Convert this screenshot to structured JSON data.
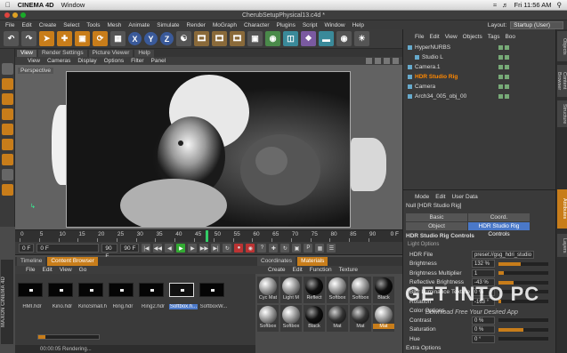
{
  "mac_menubar": {
    "app": "CINEMA 4D",
    "window_menu": "Window",
    "clock": "Fri 11:56 AM"
  },
  "window_title": "CherubSetupPhysical13.c4d *",
  "menu": [
    "File",
    "Edit",
    "Create",
    "Select",
    "Tools",
    "Mesh",
    "Animate",
    "Simulate",
    "Render",
    "MoGraph",
    "Character",
    "Plugins",
    "Script",
    "Window",
    "Help"
  ],
  "layout_label": "Layout:",
  "layout_value": "Startup (User)",
  "toolbar_axes": [
    "X",
    "Y",
    "Z"
  ],
  "viewport": {
    "tabs": [
      "View",
      "Render Settings",
      "Picture Viewer",
      "Help"
    ],
    "menu": [
      "View",
      "Cameras",
      "Display",
      "Options",
      "Filter",
      "Panel"
    ],
    "label": "Perspective"
  },
  "timeline": {
    "ticks": [
      "0",
      "5",
      "10",
      "15",
      "20",
      "25",
      "30",
      "35",
      "40",
      "45",
      "50",
      "55",
      "60",
      "65",
      "70",
      "75",
      "80",
      "85",
      "90"
    ],
    "end_label": "0 F",
    "playhead_frame": 48
  },
  "transport": {
    "start": "0 F",
    "preview_start": "0 F",
    "preview_end": "90 F",
    "end": "90 F"
  },
  "content_browser": {
    "tabs": [
      "Timeline",
      "Content Browser"
    ],
    "menu": [
      "File",
      "Edit",
      "View",
      "Go"
    ],
    "items": [
      "HMI.hdr",
      "Kino.hdr",
      "KinoSmall.hdr",
      "Ring.hdr",
      "Ring2.hdr",
      "Softbox.h...",
      "SoftboxW..."
    ],
    "selected_index": 5,
    "status": "00:00:05 Rendering...",
    "render_progress": 0.12
  },
  "maxon_label": "MAXON CINEMA 4D",
  "materials": {
    "tabs": [
      "Coordinates",
      "Materials"
    ],
    "menu": [
      "Create",
      "Edit",
      "Function",
      "Texture"
    ],
    "items": [
      {
        "name": "Cyc Mat",
        "style": "light"
      },
      {
        "name": "Light M",
        "style": "light"
      },
      {
        "name": "Reflect",
        "style": "black"
      },
      {
        "name": "Softbox",
        "style": "light"
      },
      {
        "name": "Softbox",
        "style": "light"
      },
      {
        "name": "Black",
        "style": "black"
      },
      {
        "name": "Softbox",
        "style": "light"
      },
      {
        "name": "Softbox",
        "style": "light"
      },
      {
        "name": "Black",
        "style": "black"
      },
      {
        "name": "Mat",
        "style": "dark"
      },
      {
        "name": "Mat",
        "style": "dark"
      },
      {
        "name": "Mat",
        "style": "light",
        "highlight": true
      }
    ]
  },
  "object_manager": {
    "menu": [
      "File",
      "Edit",
      "View",
      "Objects",
      "Tags",
      "Boo"
    ],
    "objects": [
      {
        "name": "HyperNURBS",
        "indent": 0
      },
      {
        "name": "Studio L",
        "indent": 1
      },
      {
        "name": "Camera.1",
        "indent": 0
      },
      {
        "name": "HDR Studio Rig",
        "indent": 0,
        "highlight": true
      },
      {
        "name": "Camera",
        "indent": 0
      },
      {
        "name": "Arch34_005_obj_00",
        "indent": 0
      }
    ]
  },
  "side_tabs": [
    "Objects",
    "Content Browser",
    "Structure",
    "Attributes",
    "Layers"
  ],
  "attributes": {
    "menu": [
      "Mode",
      "Edit",
      "User Data"
    ],
    "title": "Null [HDR Studio Rig]",
    "mode_buttons": [
      "Basic",
      "Coord.",
      "Object",
      "HDR Studio Rig Controls"
    ],
    "section": "HDR Studio Rig Controls",
    "subsection": "Light Options",
    "properties": [
      {
        "label": "HDR File",
        "value": "preset://gsg_hdri_studio",
        "fill": 0
      },
      {
        "label": "Brightness",
        "value": "132 %",
        "fill": 0.45
      },
      {
        "label": "Brightness Multiplier",
        "value": "1",
        "fill": 0.1
      },
      {
        "label": "Reflective Brightness",
        "value": "-43 %",
        "fill": 0.3
      },
      {
        "label": "Blur Luminance Texture",
        "value": "0 %",
        "fill": 0
      },
      {
        "label": "Rotation",
        "value": "-163 °",
        "fill": 0.05
      },
      {
        "label": "Color Options",
        "value": "",
        "fill": 0
      },
      {
        "label": "Contrast",
        "value": "0 %",
        "fill": 0
      },
      {
        "label": "Saturation",
        "value": "0 %",
        "fill": 0.5
      },
      {
        "label": "Hue",
        "value": "0 °",
        "fill": 0
      }
    ],
    "extra": "Extra Options"
  },
  "watermark": {
    "title": "GET INTO PC",
    "subtitle": "Download Free Your Desired App"
  },
  "colors": {
    "accent": "#c87d1a",
    "selection": "#4a78c8",
    "panel": "#3a3a3a"
  }
}
